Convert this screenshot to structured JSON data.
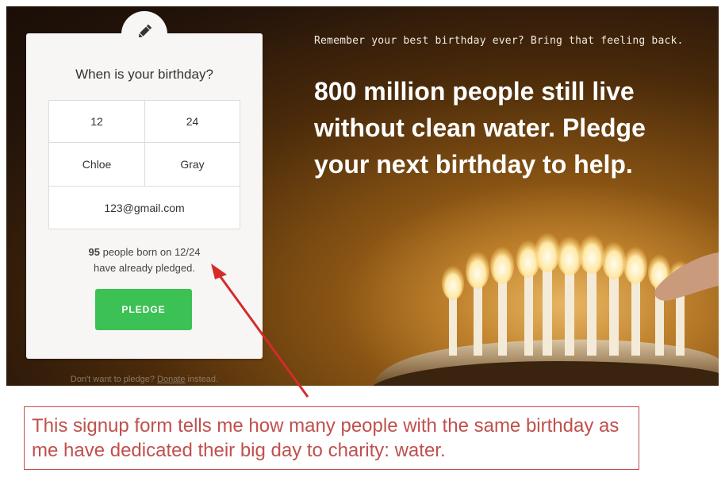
{
  "hero": {
    "tagline": "Remember your best birthday ever? Bring that feeling back.",
    "headline_lines": [
      "800 million people still live",
      "without clean water. Pledge",
      "your next birthday to help."
    ]
  },
  "form": {
    "title": "When is your birthday?",
    "month": "12",
    "day": "24",
    "first_name": "Chloe",
    "last_name": "Gray",
    "email": "123@gmail.com",
    "count": "95",
    "count_line1_rest": " people born on 12/24",
    "count_line2": "have already pledged.",
    "pledge_label": "PLEDGE",
    "edit_icon": "pencil-icon"
  },
  "footer_note": {
    "prefix": "Don't want to pledge? ",
    "link": "Donate",
    "suffix": " instead."
  },
  "annotation": {
    "caption": "This signup form tells me how many people with the same birthday as me have dedicated their big day to charity: water.",
    "color": "#c0504d"
  },
  "colors": {
    "pledge_button": "#3cc254",
    "card_background": "#f7f6f4",
    "annotation": "#c0504d"
  }
}
